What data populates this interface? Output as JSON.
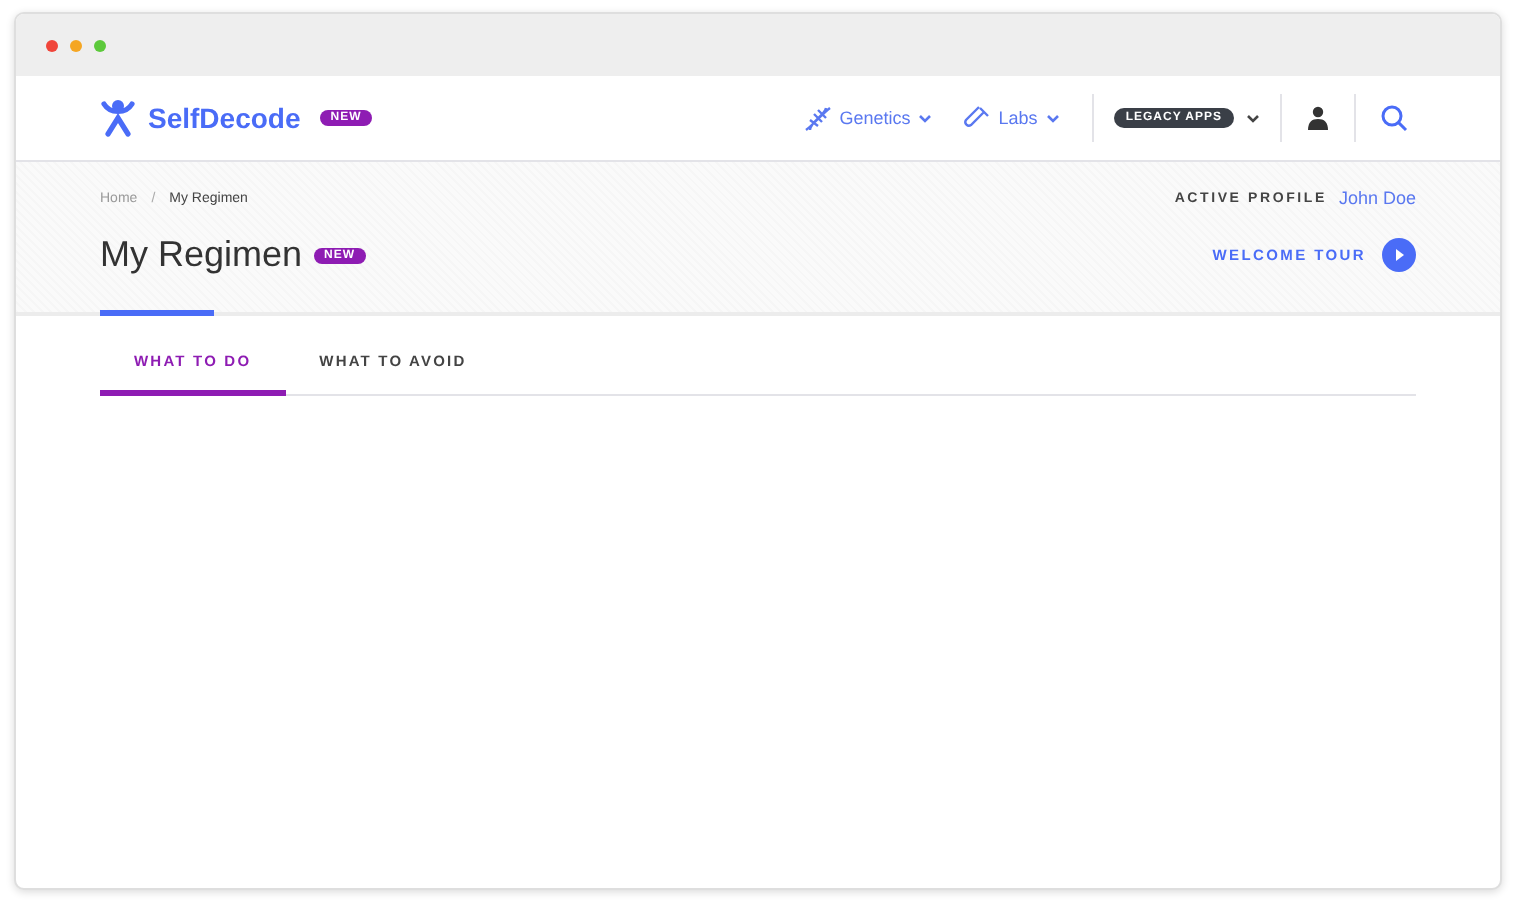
{
  "brand": {
    "name": "SelfDecode",
    "badge": "NEW"
  },
  "nav": [
    {
      "label": "Genetics",
      "kind": "dna"
    },
    {
      "label": "Labs",
      "kind": "tube"
    }
  ],
  "legacy": {
    "label": "LEGACY APPS"
  },
  "breadcrumb": [
    {
      "label": "Home",
      "current": false
    },
    {
      "label": "My Regimen",
      "current": true
    }
  ],
  "breadcrumb_separator": "/",
  "profile": {
    "label": "ACTIVE PROFILE",
    "name": "John Doe"
  },
  "page": {
    "title": "My Regimen",
    "badge": "NEW"
  },
  "tour": {
    "label": "WELCOME TOUR"
  },
  "tabs": [
    {
      "label": "WHAT TO DO",
      "selected": true
    },
    {
      "label": "WHAT TO AVOID",
      "selected": false
    }
  ]
}
